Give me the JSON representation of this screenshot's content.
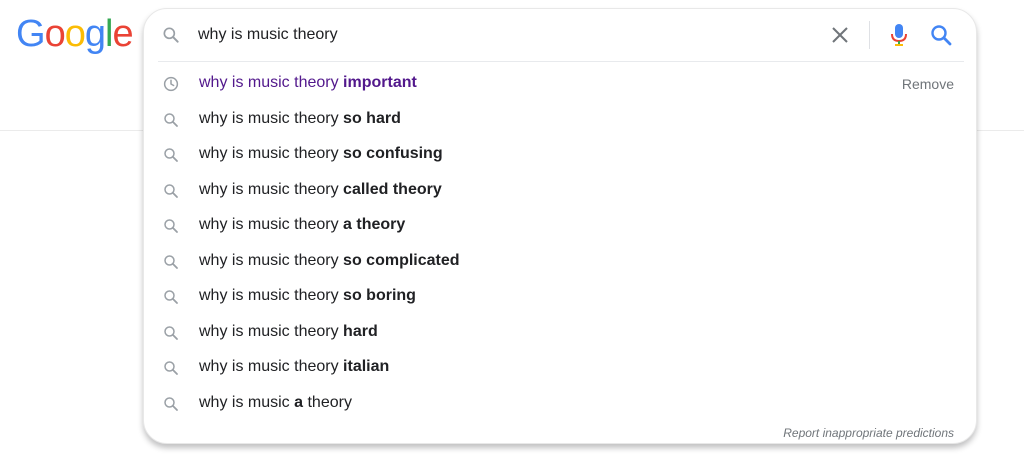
{
  "logo": {
    "letters": [
      "G",
      "o",
      "o",
      "g",
      "l",
      "e"
    ],
    "colors": [
      "#4285f4",
      "#ea4335",
      "#fbbc05",
      "#4285f4",
      "#34a853",
      "#ea4335"
    ]
  },
  "search": {
    "value": "why is music theory ",
    "icon": "search-icon",
    "clear_icon": "close-icon",
    "mic_icon": "microphone-icon",
    "submit_icon": "search-icon"
  },
  "suggestions": [
    {
      "type": "history",
      "prefix": "why is music theory ",
      "bold": "important",
      "action": "Remove"
    },
    {
      "type": "search",
      "prefix": "why is music theory ",
      "bold": "so hard"
    },
    {
      "type": "search",
      "prefix": "why is music theory ",
      "bold": "so confusing"
    },
    {
      "type": "search",
      "prefix": "why is music theory ",
      "bold": "called theory"
    },
    {
      "type": "search",
      "prefix": "why is music theory ",
      "bold": "a theory"
    },
    {
      "type": "search",
      "prefix": "why is music theory ",
      "bold": "so complicated"
    },
    {
      "type": "search",
      "prefix": "why is music theory ",
      "bold": "so boring"
    },
    {
      "type": "search",
      "prefix": "why is music theory ",
      "bold": "hard"
    },
    {
      "type": "search",
      "prefix": "why is music theory ",
      "bold": "italian"
    },
    {
      "type": "search",
      "prefix": "why is music ",
      "bold": "a",
      "suffix": " theory"
    }
  ],
  "footer": {
    "report_label": "Report inappropriate predictions"
  },
  "colors": {
    "history_text": "#52188c",
    "text": "#202124",
    "muted": "#70757a",
    "mic_blue": "#4285f4",
    "mic_red": "#ea4335"
  }
}
